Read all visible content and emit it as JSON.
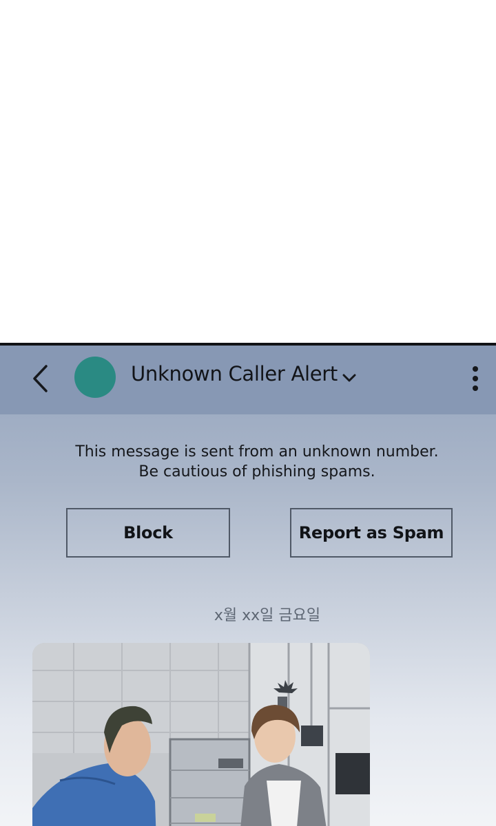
{
  "header": {
    "title": "Unknown Caller Alert",
    "avatar_color": "#2a8a83",
    "back_icon": "chevron-left-icon",
    "dropdown_icon": "chevron-down-icon",
    "menu_icon": "more-vertical-icon"
  },
  "warning": {
    "line1": "This message is sent from an unknown number.",
    "line2": "Be cautious of phishing spams."
  },
  "actions": {
    "block_label": "Block",
    "report_label": "Report as Spam"
  },
  "date_separator": "x월 xx일 금요일",
  "colors": {
    "header_bg": "#8798b4",
    "screen_top": "#93a3bd",
    "screen_bottom": "#f2f4f7"
  }
}
